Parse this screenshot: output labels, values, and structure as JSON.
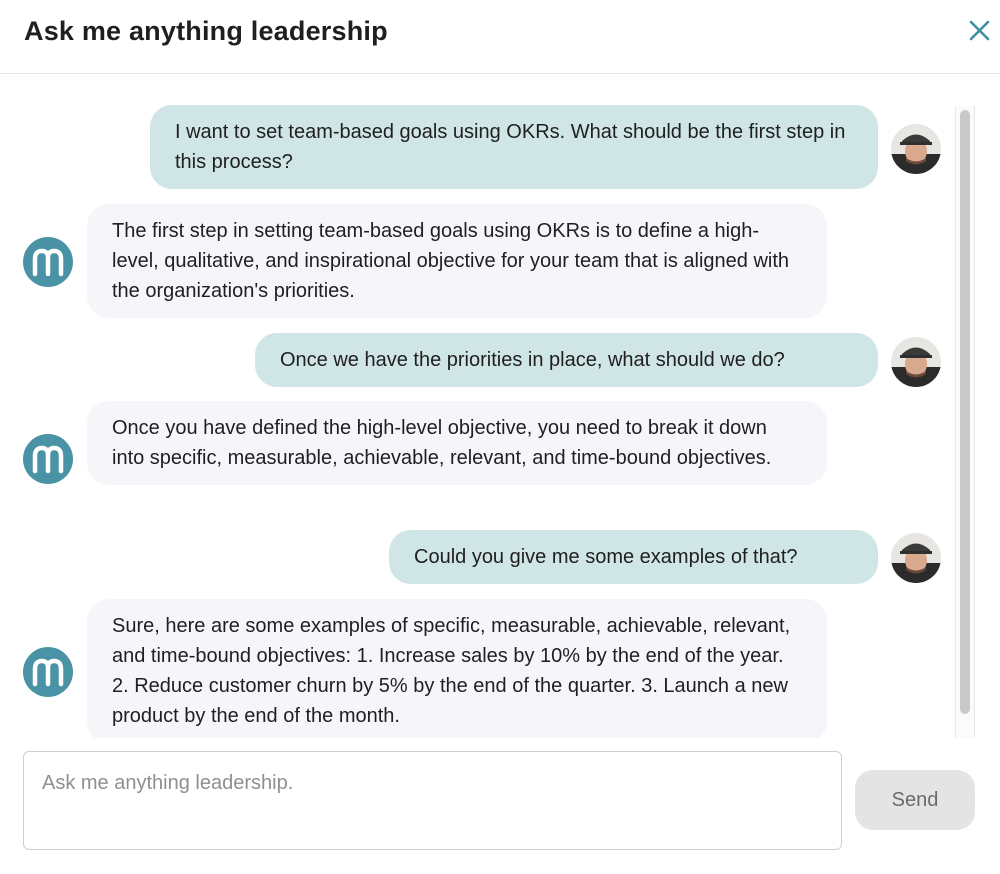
{
  "header": {
    "title": "Ask me anything leadership"
  },
  "colors": {
    "user_bubble": "#cfe5e6",
    "bot_bubble": "#f6f6fa",
    "brand_avatar": "#4a93a6",
    "close_icon": "#3f8f9f"
  },
  "messages": [
    {
      "role": "user",
      "text": "I want to set team-based goals using OKRs. What should be the first step in this process?"
    },
    {
      "role": "bot",
      "text": "The first step in setting team-based goals using OKRs is to define a high-level, qualitative, and inspirational objective for your team that is aligned with the organization's priorities."
    },
    {
      "role": "user",
      "text": "Once we have the priorities in place, what should we do?"
    },
    {
      "role": "bot",
      "text": "Once you have defined the high-level objective, you need to break it down into specific, measurable, achievable, relevant, and time-bound objectives."
    },
    {
      "role": "user",
      "text": "Could you give me some examples of that?"
    },
    {
      "role": "bot",
      "text": "Sure, here are some examples of specific, measurable, achievable, relevant, and time-bound objectives: 1. Increase sales by 10% by the end of the year. 2. Reduce customer churn by 5% by the end of the quarter. 3. Launch a new product by the end of the month."
    }
  ],
  "composer": {
    "placeholder": "Ask me anything leadership.",
    "value": ""
  },
  "send_button": {
    "label": "Send"
  },
  "icons": {
    "close": "close-icon",
    "user_avatar": "user-avatar",
    "bot_avatar": "m-logo-icon"
  }
}
